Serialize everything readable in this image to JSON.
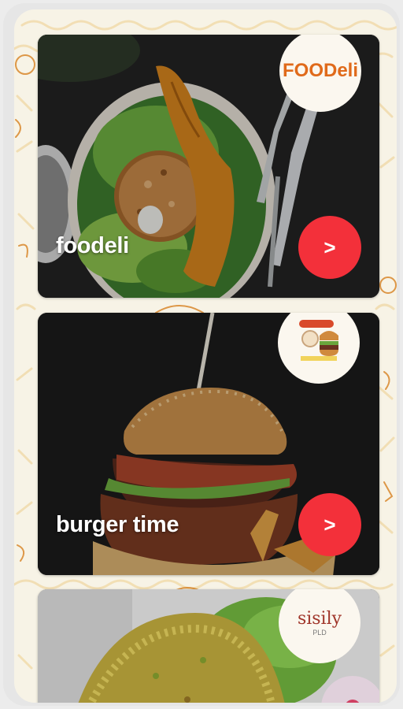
{
  "restaurants": [
    {
      "name": "foodeli",
      "logo_text": "FOODeli",
      "button_label": ">"
    },
    {
      "name": "burger time",
      "logo_text": "",
      "button_label": ">"
    },
    {
      "name": "",
      "logo_text": "sisily",
      "logo_subtext": "PLD",
      "button_label": ""
    }
  ],
  "colors": {
    "accent": "#f3303a",
    "background": "#f7f3e6",
    "pattern": "#e4a84c"
  }
}
